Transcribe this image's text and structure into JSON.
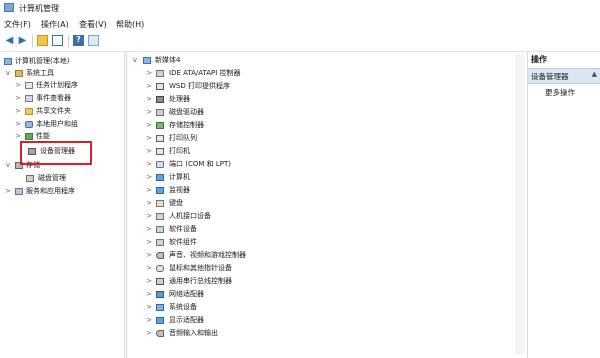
{
  "window": {
    "title": "计算机管理"
  },
  "menu": [
    "文件(F)",
    "操作(A)",
    "查看(V)",
    "帮助(H)"
  ],
  "toolbar": {
    "icons": [
      "back-arrow-icon",
      "forward-arrow-icon",
      "up-folder-icon",
      "properties-icon",
      "help-icon",
      "show-hide-icon"
    ]
  },
  "tree": {
    "root": "计算机管理(本地)",
    "system_tools": "系统工具",
    "task_scheduler": "任务计划程序",
    "event_viewer": "事件查看器",
    "shared_folders": "共享文件夹",
    "local_users": "本地用户和组",
    "performance": "性能",
    "device_manager": "设备管理器",
    "storage": "存储",
    "disk_management": "磁盘管理",
    "services": "服务和应用程序"
  },
  "devices": {
    "computer_name": "新媒体4",
    "items": [
      "IDE ATA/ATAPI 控制器",
      "WSD 打印提供程序",
      "处理器",
      "磁盘驱动器",
      "存储控制器",
      "打印队列",
      "打印机",
      "端口 (COM 和 LPT)",
      "计算机",
      "监视器",
      "键盘",
      "人机接口设备",
      "软件设备",
      "软件组件",
      "声音、视频和游戏控制器",
      "鼠标和其他指针设备",
      "通用串行总线控制器",
      "网络适配器",
      "系统设备",
      "显示适配器",
      "音频输入和输出"
    ]
  },
  "actions": {
    "title": "操作",
    "header": "设备管理器",
    "more": "更多操作"
  }
}
